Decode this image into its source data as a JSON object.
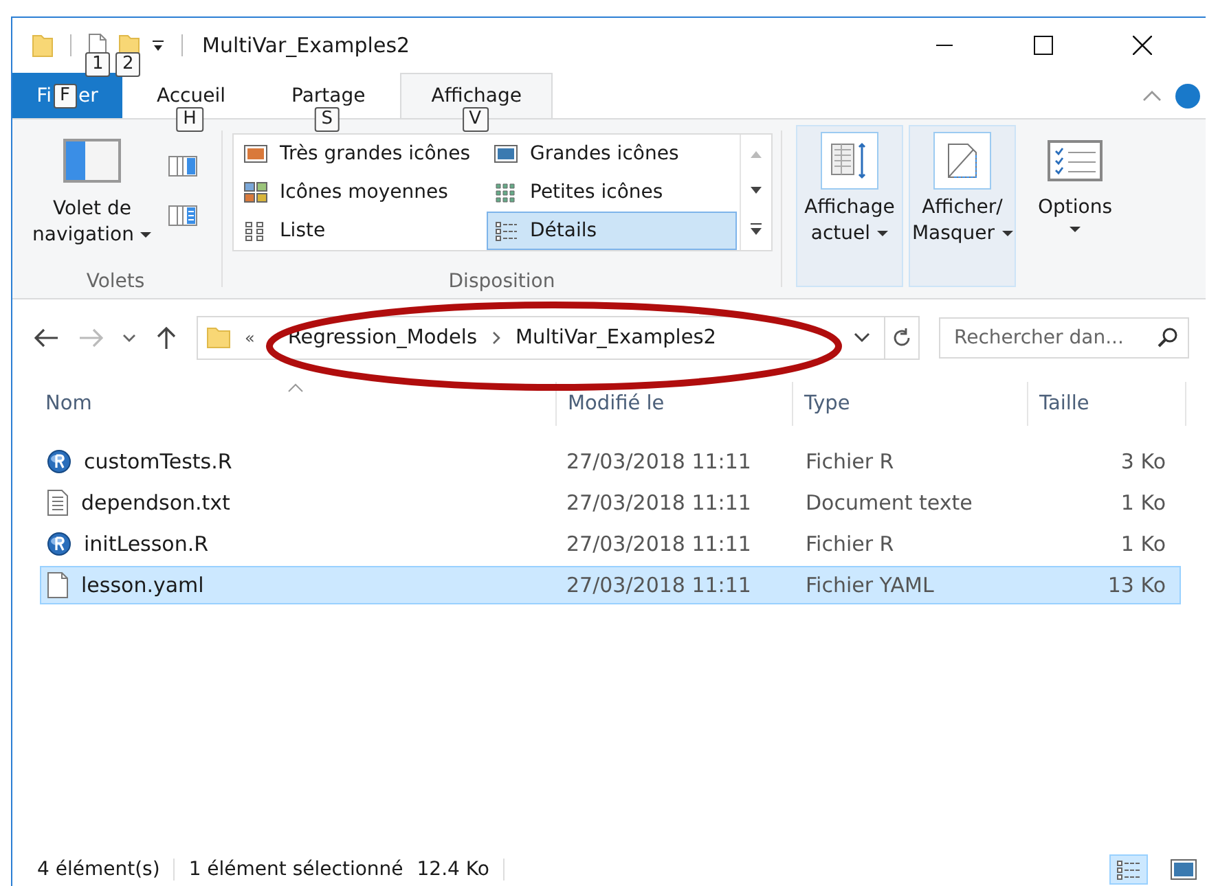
{
  "title_bar": {
    "title": "MultiVar_Examples2",
    "keytips": [
      "1",
      "2"
    ]
  },
  "ribbon": {
    "tabs": [
      {
        "label": "Fi",
        "label_end": "er",
        "kind": "file",
        "keytip": "F"
      },
      {
        "label": "Accueil",
        "kind": "tab",
        "keytip": "H",
        "selected": false
      },
      {
        "label": "Partage",
        "kind": "tab",
        "keytip": "S",
        "selected": false
      },
      {
        "label": "Affichage",
        "kind": "tab",
        "keytip": "V",
        "selected": true
      }
    ],
    "panes_group": {
      "label": "Volets",
      "button": "Volet de\nnavigation"
    },
    "layout_group": {
      "label": "Disposition",
      "options": [
        {
          "label": "Très grandes icônes",
          "selected": false
        },
        {
          "label": "Grandes icônes",
          "selected": false
        },
        {
          "label": "Icônes moyennes",
          "selected": false
        },
        {
          "label": "Petites icônes",
          "selected": false
        },
        {
          "label": "Liste",
          "selected": false
        },
        {
          "label": "Détails",
          "selected": true
        }
      ]
    },
    "view_buttons": [
      {
        "label": "Affichage\nactuel",
        "kind": "sort",
        "highlighted": true
      },
      {
        "label": "Afficher/\nMasquer",
        "kind": "showhide",
        "highlighted": true
      },
      {
        "label": "Options",
        "kind": "options",
        "highlighted": false
      }
    ]
  },
  "address_bar": {
    "overflow": "«",
    "path": [
      "Regression_Models",
      "MultiVar_Examples2"
    ],
    "search_placeholder": "Rechercher dan..."
  },
  "table": {
    "columns": [
      {
        "label": "Nom",
        "sorted": true
      },
      {
        "label": "Modifié le",
        "sorted": false
      },
      {
        "label": "Type",
        "sorted": false
      },
      {
        "label": "Taille",
        "sorted": false
      }
    ],
    "rows": [
      {
        "name": "customTests.R",
        "kind": "r",
        "modified": "27/03/2018 11:11",
        "type": "Fichier R",
        "size": "3 Ko",
        "selected": false
      },
      {
        "name": "dependson.txt",
        "kind": "text",
        "modified": "27/03/2018 11:11",
        "type": "Document texte",
        "size": "1 Ko",
        "selected": false
      },
      {
        "name": "initLesson.R",
        "kind": "r",
        "modified": "27/03/2018 11:11",
        "type": "Fichier R",
        "size": "1 Ko",
        "selected": false
      },
      {
        "name": "lesson.yaml",
        "kind": "blank",
        "modified": "27/03/2018 11:11",
        "type": "Fichier YAML",
        "size": "13 Ko",
        "selected": true
      }
    ]
  },
  "status_bar": {
    "count": "4 élément(s)",
    "selection": "1 élément sélectionné",
    "size": "12.4 Ko",
    "views": [
      {
        "kind": "details",
        "selected": true
      },
      {
        "kind": "large",
        "selected": false
      }
    ]
  }
}
